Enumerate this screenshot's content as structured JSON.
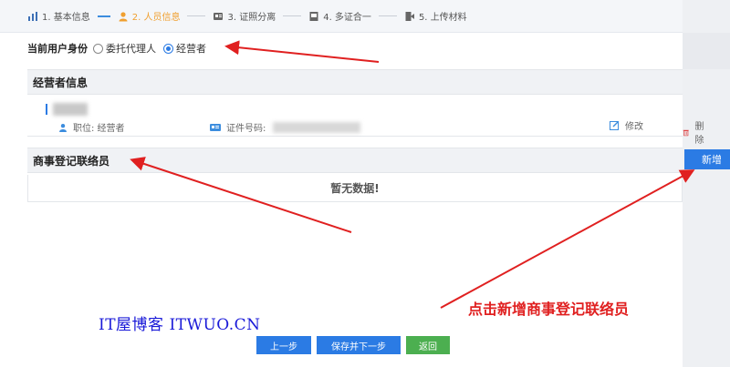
{
  "steps": [
    {
      "label": "1. 基本信息",
      "icon": "bar-chart-icon",
      "active": false
    },
    {
      "label": "2. 人员信息",
      "icon": "person-icon",
      "active": true
    },
    {
      "label": "3. 证照分离",
      "icon": "license-icon",
      "active": false
    },
    {
      "label": "4. 多证合一",
      "icon": "certificate-icon",
      "active": false
    },
    {
      "label": "5. 上传材料",
      "icon": "upload-icon",
      "active": false
    }
  ],
  "identity": {
    "label": "当前用户身份",
    "options": [
      "委托代理人",
      "经营者"
    ],
    "selected": "经营者"
  },
  "operator_section": {
    "title": "经营者信息",
    "position_label": "职位: 经营者",
    "id_label": "证件号码:",
    "edit_label": "修改",
    "delete_label": "删除"
  },
  "contact_section": {
    "title": "商事登记联络员",
    "add_label": "新增",
    "empty_text": "暂无数据!"
  },
  "footer": {
    "prev_label": "上一步",
    "save_next_label": "保存并下一步",
    "back_label": "返回"
  },
  "watermark": "IT屋博客 ITWUO.CN",
  "annotation": "点击新增商事登记联络员",
  "colors": {
    "accent": "#2b7be4",
    "active_step": "#f0a030",
    "arrow": "#e02020",
    "back_button": "#4caf50"
  }
}
